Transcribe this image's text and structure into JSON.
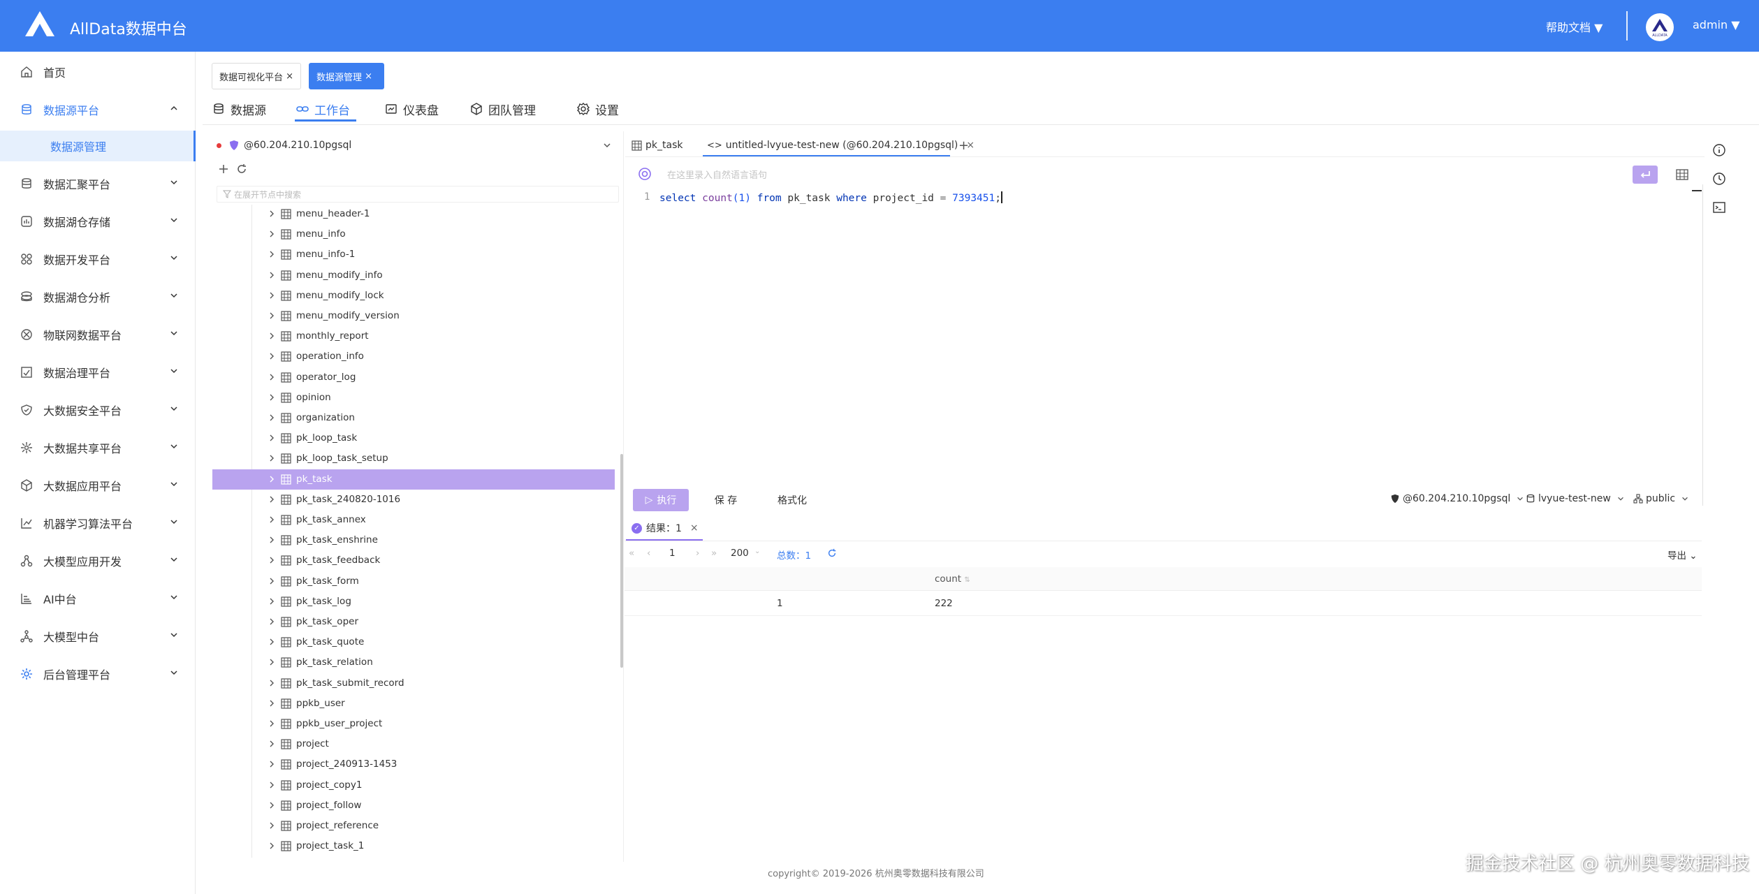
{
  "header": {
    "title": "AllData数据中台",
    "help": "帮助文档",
    "user": "admin",
    "avatar_text": "ALLDATA"
  },
  "sidebar": {
    "items": [
      {
        "label": "首页",
        "icon": "home-icon"
      },
      {
        "label": "数据源平台",
        "icon": "database-icon"
      },
      {
        "label": "数据汇聚平台",
        "icon": "database-icon"
      },
      {
        "label": "数据湖仓存储",
        "icon": "lake-icon"
      },
      {
        "label": "数据开发平台",
        "icon": "dev-icon"
      },
      {
        "label": "数据湖仓分析",
        "icon": "analysis-icon"
      },
      {
        "label": "物联网数据平台",
        "icon": "iot-icon"
      },
      {
        "label": "数据治理平台",
        "icon": "governance-icon"
      },
      {
        "label": "大数据安全平台",
        "icon": "shield-icon"
      },
      {
        "label": "大数据共享平台",
        "icon": "share-icon"
      },
      {
        "label": "大数据应用平台",
        "icon": "cube-icon"
      },
      {
        "label": "机器学习算法平台",
        "icon": "ml-icon"
      },
      {
        "label": "大模型应用开发",
        "icon": "llm-app-icon"
      },
      {
        "label": "AI中台",
        "icon": "ai-icon"
      },
      {
        "label": "大模型中台",
        "icon": "llm-icon"
      },
      {
        "label": "后台管理平台",
        "icon": "gear-icon"
      }
    ],
    "sub_item": "数据源管理"
  },
  "tags": [
    {
      "label": "数据可视化平台",
      "close": "×"
    },
    {
      "label": "数据源管理",
      "close": "×"
    }
  ],
  "nav_tabs": [
    {
      "label": "数据源"
    },
    {
      "label": "工作台"
    },
    {
      "label": "仪表盘"
    },
    {
      "label": "团队管理"
    },
    {
      "label": "设置"
    }
  ],
  "tree": {
    "datasource": "@60.204.210.10pgsql",
    "filter_placeholder": "在展开节点中搜索",
    "tables": [
      "menu_header-1",
      "menu_info",
      "menu_info-1",
      "menu_modify_info",
      "menu_modify_lock",
      "menu_modify_version",
      "monthly_report",
      "operation_info",
      "operator_log",
      "opinion",
      "organization",
      "pk_loop_task",
      "pk_loop_task_setup",
      "pk_task",
      "pk_task_240820-1016",
      "pk_task_annex",
      "pk_task_enshrine",
      "pk_task_feedback",
      "pk_task_form",
      "pk_task_log",
      "pk_task_oper",
      "pk_task_quote",
      "pk_task_relation",
      "pk_task_submit_record",
      "ppkb_user",
      "ppkb_user_project",
      "project",
      "project_240913-1453",
      "project_copy1",
      "project_follow",
      "project_reference",
      "project_task_1"
    ],
    "selected": "pk_task"
  },
  "editor": {
    "tabs": [
      {
        "label": "pk_task"
      },
      {
        "label": "untitled-lvyue-test-new (@60.204.210.10pgsql)",
        "close": "×"
      }
    ],
    "add": "+",
    "nl_placeholder": "在这里录入自然语言语句",
    "line_no": "1",
    "sql": {
      "t1": "select",
      "t2": "count",
      "t3": "(1)",
      "t4": "from",
      "t5": "pk_task",
      "t6": "where",
      "t7": "project_id",
      "t8": "=",
      "t9": "7393451",
      "t10": ";"
    }
  },
  "toolbar": {
    "run": "执行",
    "save": "保 存",
    "format": "格式化",
    "datasource": "@60.204.210.10pgsql",
    "database": "lvyue-test-new",
    "schema": "public"
  },
  "result": {
    "tab": "结果：1",
    "page": "1",
    "page_size": "200",
    "total": "总数：1",
    "export": "导出",
    "columns": [
      "count"
    ],
    "rows": [
      {
        "index": "1",
        "count": "222"
      }
    ]
  },
  "footer": "copyright© 2019-2026 杭州奥零数据科技有限公司",
  "watermark": "掘金技术社区 @ 杭州奥零数据科技"
}
